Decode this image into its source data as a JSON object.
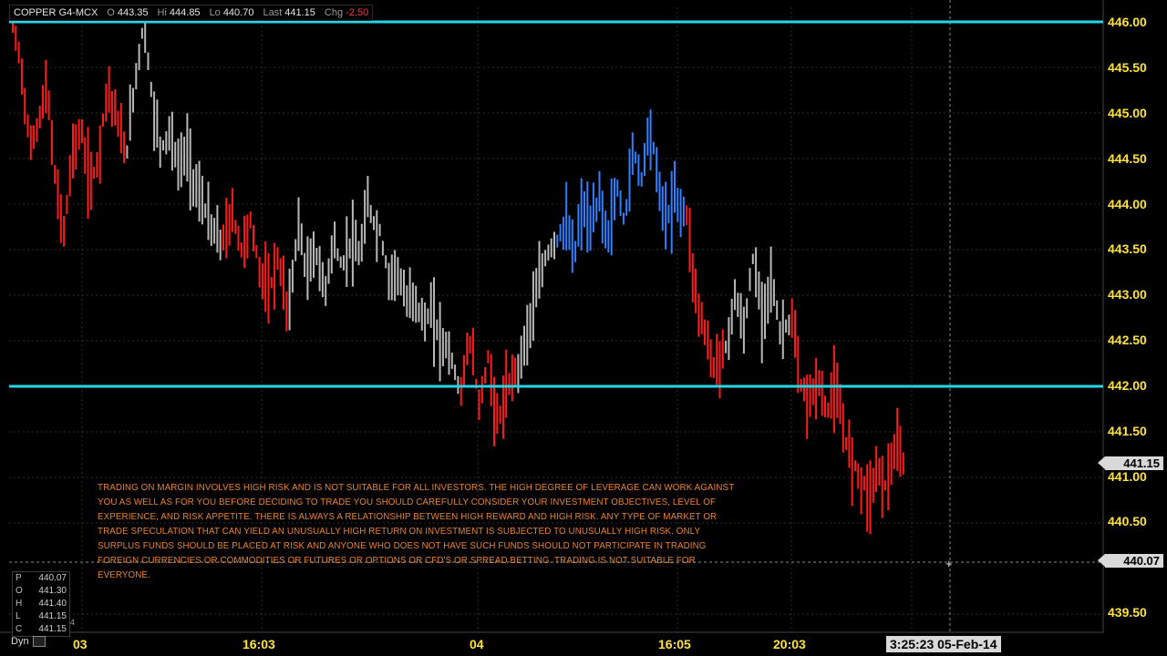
{
  "header": {
    "symbol": "COPPER G4-MCX",
    "open_label": "O",
    "open_value": "443.35",
    "high_label": "Hi",
    "high_value": "444.85",
    "low_label": "Lo",
    "low_value": "440.70",
    "last_label": "Last",
    "last_value": "441.15",
    "chg_label": "Chg",
    "chg_value": "-2.50"
  },
  "disclaimer": "TRADING ON MARGIN INVOLVES HIGH RISK AND IS NOT SUITABLE FOR ALL INVESTORS. THE HIGH DEGREE OF LEVERAGE CAN WORK AGAINST YOU AS WELL AS FOR YOU BEFORE DECIDING TO TRADE YOU SHOULD CAREFULLY CONSIDER YOUR INVESTMENT OBJECTIVES, LEVEL OF EXPERIENCE, AND RISK APPETITE. THERE IS ALWAYS A RELATIONSHIP BETWEEN HIGH REWARD AND HIGH RISK. ANY TYPE OF MARKET OR TRADE SPECULATION THAT CAN YIELD AN UNUSUALLY HIGH RETURN ON INVESTMENT IS SUBJECTED TO UNUSUALLY HIGH RISK. ONLY SURPLUS FUNDS SHOULD BE PLACED AT RISK AND ANYONE WHO DOES NOT HAVE SUCH FUNDS SHOULD NOT PARTICIPATE IN TRADING FOREIGN CURRENCIES OR COMMODITIES OR FUTURES OR OPTIONS OR CFD'S OR SPREAD BETTING. TRADING IS NOT SUITABLE FOR EVERYONE.",
  "ohlc_panel": {
    "rows": [
      {
        "label": "P",
        "value": "440.07"
      },
      {
        "label": "O",
        "value": "441.30"
      },
      {
        "label": "H",
        "value": "441.40"
      },
      {
        "label": "L",
        "value": "441.15"
      },
      {
        "label": "C",
        "value": "441.15"
      }
    ],
    "dyn_label": "Dyn",
    "small_digit": "4"
  },
  "time_readout": "3:25:23 05-Feb-14",
  "chart_data": {
    "type": "bar",
    "instrument": "COPPER G4-MCX",
    "y_axis": {
      "ticks": [
        "446.00",
        "445.50",
        "445.00",
        "444.50",
        "444.00",
        "443.50",
        "443.00",
        "442.50",
        "442.00",
        "441.50",
        "441.00",
        "440.50",
        "439.50"
      ],
      "range": [
        439.5,
        446.0
      ]
    },
    "x_axis": {
      "ticks": [
        "03",
        "16:03",
        "04",
        "16:05",
        "20:03"
      ]
    },
    "horizontal_lines": [
      446.0,
      442.0
    ],
    "price_tags": [
      {
        "label": "441.15",
        "value": 441.15
      },
      {
        "label": "440.07",
        "value": 440.07
      }
    ],
    "crosshair_price": 440.07,
    "colors": {
      "down": "#ff1a1a",
      "neutral": "#b8b8b8",
      "up": "#2f7fff",
      "level_line": "#24d6e6",
      "grid": "#2b2b2b",
      "axis_text": "#ffe23a"
    },
    "segments": [
      {
        "color": "down",
        "points": [
          446.0,
          445.5,
          444.6,
          444.9,
          445.3,
          444.2,
          443.7,
          444.6,
          444.8,
          444.2,
          444.5,
          445.3,
          445.0,
          444.6
        ]
      },
      {
        "color": "neutral",
        "points": [
          444.6,
          445.4,
          446.0,
          445.1,
          444.6,
          444.8,
          444.4,
          444.6,
          444.2,
          444.0,
          443.7,
          443.6
        ]
      },
      {
        "color": "down",
        "points": [
          443.6,
          443.9,
          443.5,
          443.8,
          443.3,
          443.0,
          443.4,
          442.9
        ]
      },
      {
        "color": "neutral",
        "points": [
          442.9,
          443.8,
          443.2,
          443.5,
          443.0,
          443.6,
          443.3,
          443.6,
          443.4,
          444.0,
          443.7
        ]
      },
      {
        "color": "neutral",
        "points": [
          443.7,
          443.2,
          443.3,
          442.9,
          443.0,
          442.7,
          442.8,
          442.5,
          442.4,
          442.0
        ]
      },
      {
        "color": "down",
        "points": [
          442.0,
          442.5,
          441.8,
          442.3,
          441.6,
          441.9,
          442.2
        ]
      },
      {
        "color": "neutral",
        "points": [
          442.2,
          442.6,
          443.0,
          443.4,
          443.6
        ]
      },
      {
        "color": "up",
        "points": [
          443.6,
          443.8,
          443.4,
          444.0,
          443.7,
          444.1,
          443.6,
          444.2,
          443.8,
          444.6,
          444.3,
          444.9,
          444.2,
          443.8,
          444.1,
          443.9
        ]
      },
      {
        "color": "down",
        "points": [
          443.9,
          443.0,
          442.6,
          442.2,
          442.4
        ]
      },
      {
        "color": "neutral",
        "points": [
          442.4,
          443.0,
          442.6,
          443.4,
          442.8,
          443.2,
          442.6,
          442.7
        ]
      },
      {
        "color": "down",
        "points": [
          442.7,
          442.0,
          441.8,
          442.1,
          441.7,
          442.0,
          441.5,
          441.2,
          441.0,
          440.8,
          441.1,
          440.9,
          441.3,
          441.15
        ]
      }
    ]
  }
}
